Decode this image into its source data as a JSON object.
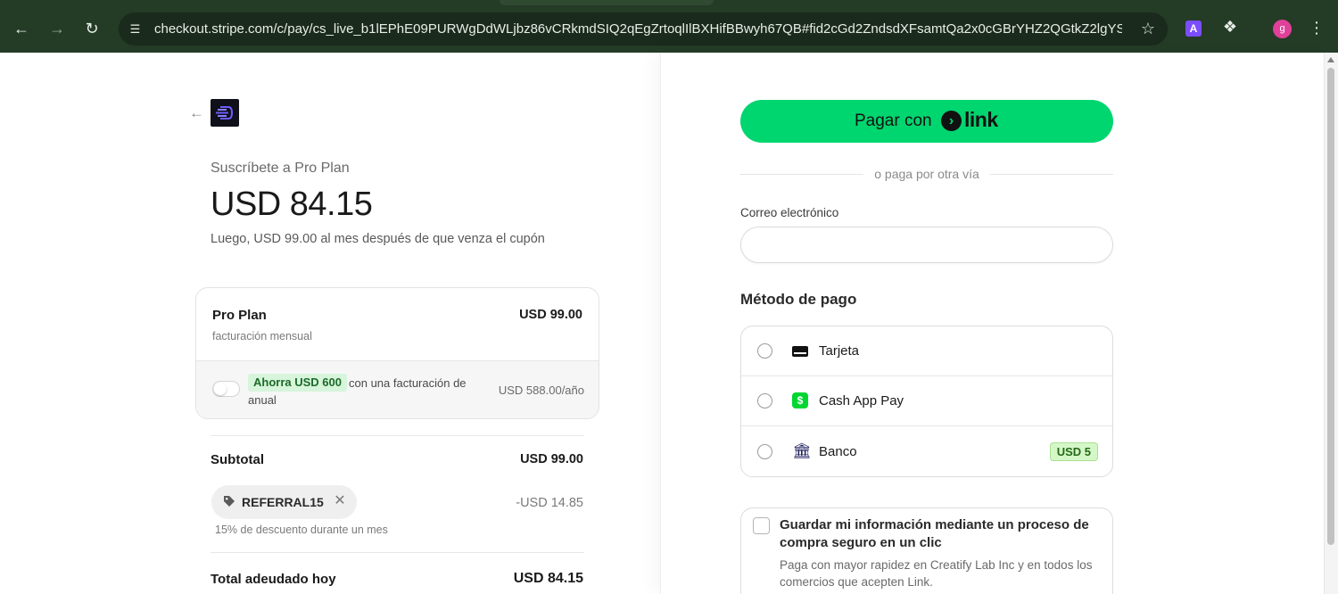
{
  "browser": {
    "url": "checkout.stripe.com/c/pay/cs_live_b1lEPhE09PURWgDdWLjbz86vCRkmdSIQ2qEgZrtoqlIlBXHifBBwyh67QB#fid2cGd2ZndsdXFsamtQa2x0cGBrYHZ2QGtkZ2lgYS...",
    "ext_label": "A",
    "profile_initial": "g"
  },
  "summary": {
    "subscribe_title": "Suscríbete a Pro Plan",
    "price": "USD 84.15",
    "price_note": "Luego, USD 99.00 al mes después de que venza el cupón",
    "plan": {
      "name": "Pro Plan",
      "price": "USD 99.00",
      "billing": "facturación mensual"
    },
    "upsell": {
      "badge": "Ahorra USD 600",
      "text_line1": "con una facturación de",
      "text_line2": "anual",
      "price": "USD 588.00/año"
    },
    "subtotal_label": "Subtotal",
    "subtotal_value": "USD 99.00",
    "coupon_code": "REFERRAL15",
    "discount_value": "-USD 14.85",
    "discount_note": "15% de descuento durante un mes",
    "total_label": "Total adeudado hoy",
    "total_value": "USD 84.15"
  },
  "payment": {
    "link_button_text": "Pagar con",
    "link_brand": "link",
    "or_text": "o paga por otra vía",
    "email_label": "Correo electrónico",
    "email_value": "",
    "method_heading": "Método de pago",
    "methods": [
      {
        "label": "Tarjeta",
        "icon": "credit-card-icon"
      },
      {
        "label": "Cash App Pay",
        "icon": "cash-app-icon"
      },
      {
        "label": "Banco",
        "icon": "bank-icon",
        "badge": "USD 5"
      }
    ],
    "save_info": {
      "title": "Guardar mi información mediante un proceso de compra seguro en un clic",
      "description": "Paga con mayor rapidez en Creatify Lab Inc y en todos los comercios que acepten Link."
    }
  },
  "colors": {
    "link_green": "#00d66f",
    "chrome_bg": "#243b26",
    "save_badge_bg": "#d6f5da",
    "bank_badge_bg": "#d5f7c8"
  }
}
